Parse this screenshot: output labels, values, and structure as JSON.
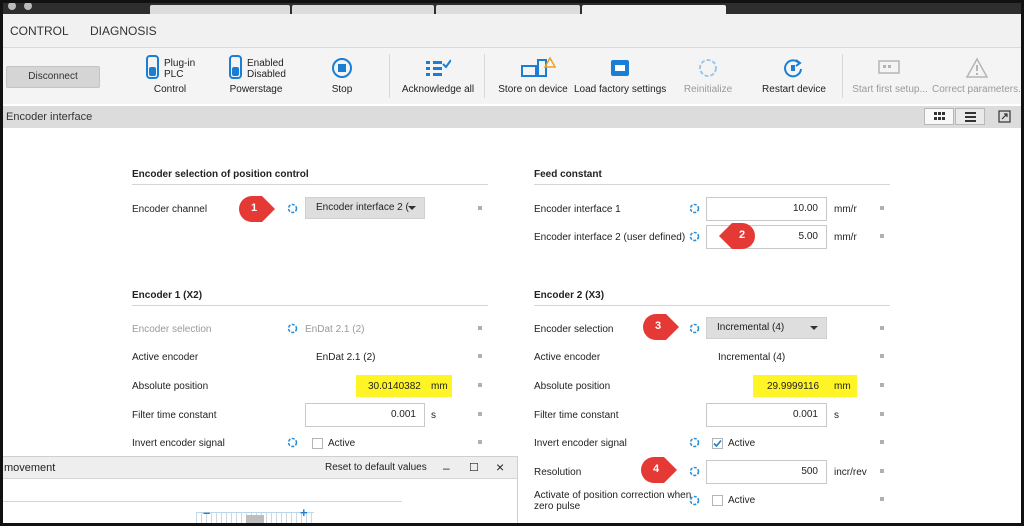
{
  "menu": {
    "control": "CONTROL",
    "diagnosis": "DIAGNOSIS"
  },
  "toolbar": {
    "disconnect": "Disconnect",
    "plc_top": "Plug-in",
    "plc_bottom": "PLC",
    "control": "Control",
    "pw_top": "Enabled",
    "pw_bottom": "Disabled",
    "powerstage": "Powerstage",
    "stop": "Stop",
    "ack": "Acknowledge all",
    "store": "Store on device",
    "factory": "Load factory settings",
    "reinit": "Reinitialize",
    "restart": "Restart device",
    "first_setup": "Start first setup...",
    "correct": "Correct parameters..."
  },
  "section": {
    "title": "Encoder interface"
  },
  "pos_control": {
    "heading": "Encoder selection of position control",
    "channel_label": "Encoder channel",
    "channel_value": "Encoder interface 2 ("
  },
  "feed": {
    "heading": "Feed constant",
    "if1_label": "Encoder interface 1",
    "if1_value": "10.00",
    "if1_unit": "mm/r",
    "if2_label": "Encoder interface 2 (user defined)",
    "if2_value": "5.00",
    "if2_unit": "mm/r"
  },
  "enc1": {
    "heading": "Encoder 1 (X2)",
    "sel_label": "Encoder selection",
    "sel_value": "EnDat 2.1 (2)",
    "active_label": "Active encoder",
    "active_value": "EnDat 2.1 (2)",
    "abs_label": "Absolute position",
    "abs_value": "30.0140382",
    "abs_unit": "mm",
    "filter_label": "Filter time constant",
    "filter_value": "0.001",
    "filter_unit": "s",
    "invert_label": "Invert encoder signal",
    "invert_text": "Active"
  },
  "enc2": {
    "heading": "Encoder 2 (X3)",
    "sel_label": "Encoder selection",
    "sel_value": "Incremental (4)",
    "active_label": "Active encoder",
    "active_value": "Incremental (4)",
    "abs_label": "Absolute position",
    "abs_value": "29.9999116",
    "abs_unit": "mm",
    "filter_label": "Filter time constant",
    "filter_value": "0.001",
    "filter_unit": "s",
    "invert_label": "Invert encoder signal",
    "invert_text": "Active",
    "res_label": "Resolution",
    "res_value": "500",
    "res_unit": "incr/rev",
    "zero_label_1": "Activate of position correction when",
    "zero_label_2": "zero pulse",
    "zero_text": "Active"
  },
  "markers": {
    "m1": "1",
    "m2": "2",
    "m3": "3",
    "m4": "4"
  },
  "subwin": {
    "title": "movement",
    "reset": "Reset to default values",
    "min": "–",
    "max": "☐",
    "close": "×",
    "minus": "–",
    "plus": "+"
  },
  "colors": {
    "highlight": "#fff200",
    "marker": "#e53935",
    "accent": "#1a7fd4"
  }
}
